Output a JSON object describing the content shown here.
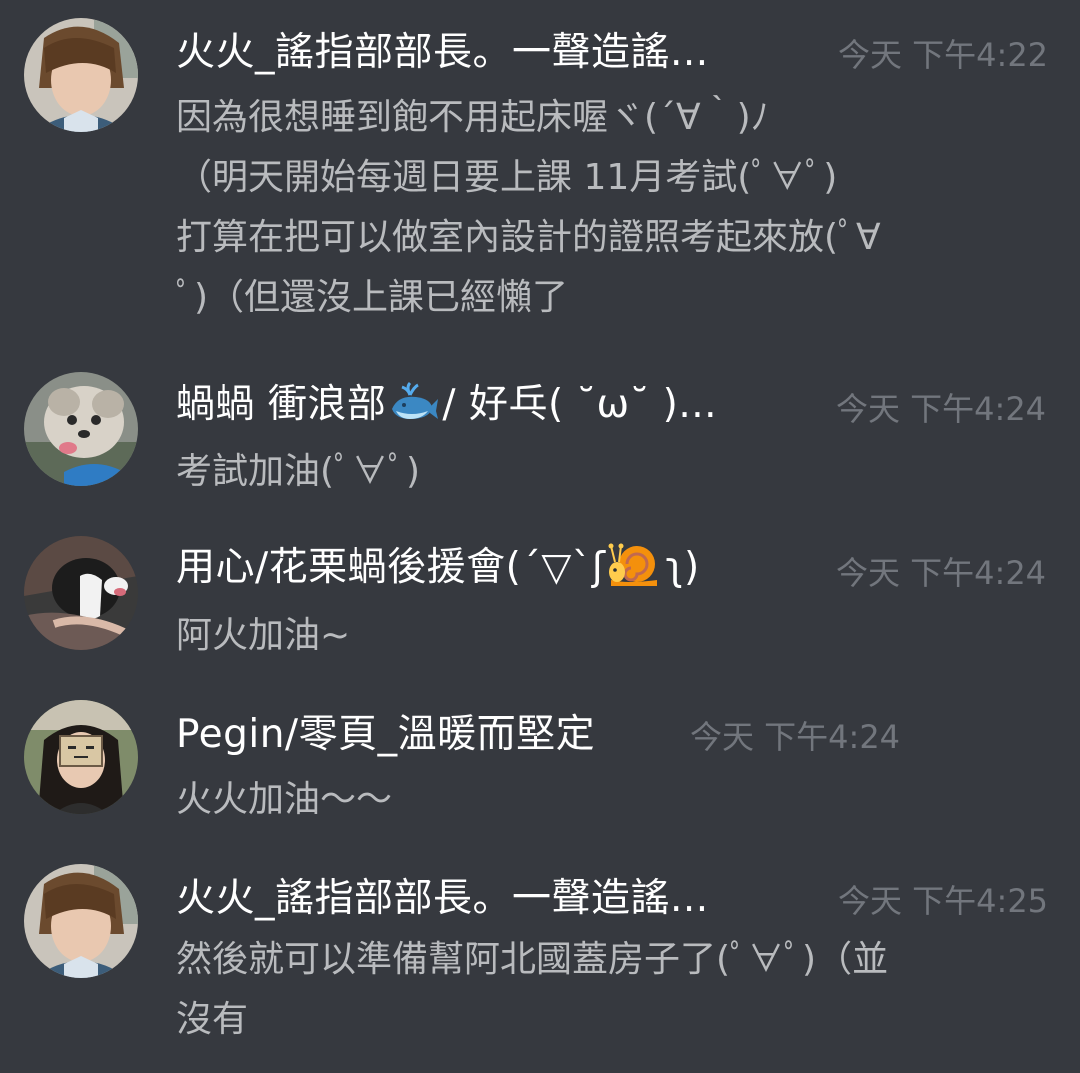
{
  "messages": [
    {
      "username": "火火_謠指部部長。一聲造謠...",
      "timestamp": "今天 下午4:22",
      "lines": [
        "因為很想睡到飽不用起床喔ヾ(´∀｀)ﾉ",
        "（明天開始每週日要上課 11月考試(ﾟ∀ﾟ)",
        "打算在把可以做室內設計的證照考起來放(ﾟ∀",
        "ﾟ)（但還沒上課已經懶了"
      ]
    },
    {
      "username_before": "蝸蝸 衝浪部",
      "username_emoji": "whale-emoji",
      "username_after": "/ 好乓( ˘ω˘ )...",
      "timestamp": "今天 下午4:24",
      "lines": [
        "考試加油(ﾟ∀ﾟ)"
      ]
    },
    {
      "username_before": "用心/花栗蝸後援會(´▽`ʃ",
      "username_emoji": "snail-emoji",
      "username_after": "ʅ)",
      "timestamp": "今天 下午4:24",
      "lines": [
        "阿火加油~"
      ]
    },
    {
      "username": "Pegin/零頁_溫暖而堅定",
      "timestamp": "今天 下午4:24",
      "lines": [
        "火火加油～～"
      ]
    },
    {
      "username": "火火_謠指部部長。一聲造謠...",
      "timestamp": "今天 下午4:25",
      "lines": [
        "然後就可以準備幫阿北國蓋房子了(ﾟ∀ﾟ)（並",
        "沒有"
      ]
    }
  ],
  "colors": {
    "background": "#36393f",
    "username": "#ffffff",
    "message_text": "#b9bbbe",
    "timestamp": "#72767d"
  }
}
